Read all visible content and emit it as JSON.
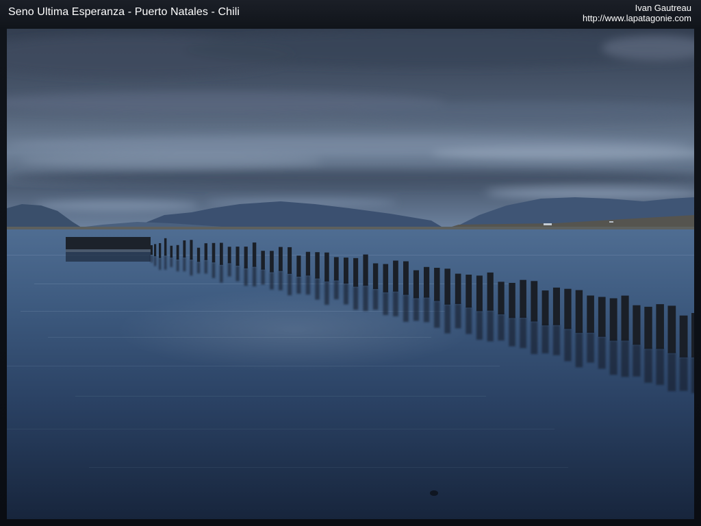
{
  "header": {
    "title": "Seno Ultima Esperanza - Puerto Natales - Chili",
    "author": "Ivan Gautreau",
    "website": "http://www.lapatagonie.com"
  },
  "photo": {
    "colors": {
      "frame": "#0a0d13",
      "sky_top": "#323d4f",
      "sky_band": "#8a9bb3",
      "mountains": "#3d536f",
      "shore": "#5c5a52",
      "water_top": "#506e94",
      "water_bottom": "#16243b",
      "posts": "#1a1f26"
    }
  }
}
